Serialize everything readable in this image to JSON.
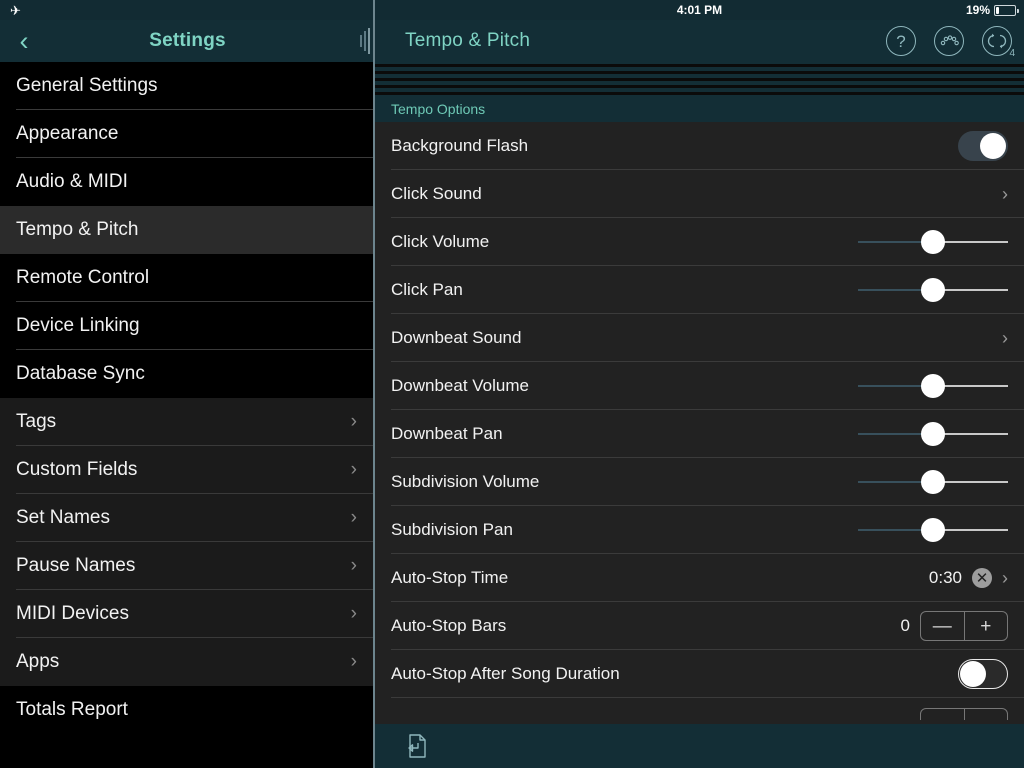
{
  "status_bar": {
    "airplane_icon": "airplane-mode-icon",
    "time": "4:01 PM",
    "battery_percent": "19%",
    "battery_level": 19
  },
  "sidebar": {
    "title": "Settings",
    "back_icon": "back-chevron-icon",
    "items": [
      {
        "label": "General Settings",
        "chevron": false,
        "group": false,
        "selected": false
      },
      {
        "label": "Appearance",
        "chevron": false,
        "group": false,
        "selected": false
      },
      {
        "label": "Audio & MIDI",
        "chevron": false,
        "group": false,
        "selected": false
      },
      {
        "label": "Tempo & Pitch",
        "chevron": false,
        "group": false,
        "selected": true
      },
      {
        "label": "Remote Control",
        "chevron": false,
        "group": false,
        "selected": false
      },
      {
        "label": "Device Linking",
        "chevron": false,
        "group": false,
        "selected": false
      },
      {
        "label": "Database Sync",
        "chevron": false,
        "group": false,
        "selected": false
      },
      {
        "label": "Tags",
        "chevron": true,
        "group": true,
        "selected": false
      },
      {
        "label": "Custom Fields",
        "chevron": true,
        "group": true,
        "selected": false
      },
      {
        "label": "Set Names",
        "chevron": true,
        "group": true,
        "selected": false
      },
      {
        "label": "Pause Names",
        "chevron": true,
        "group": true,
        "selected": false
      },
      {
        "label": "MIDI Devices",
        "chevron": true,
        "group": true,
        "selected": false
      },
      {
        "label": "Apps",
        "chevron": true,
        "group": true,
        "selected": false
      },
      {
        "label": "Totals Report",
        "chevron": false,
        "group": false,
        "selected": false
      }
    ]
  },
  "detail": {
    "title": "Tempo & Pitch",
    "actions": [
      {
        "name": "help-button",
        "icon": "question-mark-icon",
        "glyph": "?",
        "badge": ""
      },
      {
        "name": "metronome-button",
        "icon": "metronome-icon",
        "glyph": "",
        "badge": ""
      },
      {
        "name": "loop-button",
        "icon": "loop-icon",
        "glyph": "",
        "badge": "4"
      }
    ],
    "section_header": "Tempo Options",
    "rows": [
      {
        "label": "Background Flash",
        "control": "toggle",
        "value": "on"
      },
      {
        "label": "Click Sound",
        "control": "chevron",
        "value": ""
      },
      {
        "label": "Click Volume",
        "control": "slider",
        "value": 50
      },
      {
        "label": "Click Pan",
        "control": "slider",
        "value": 50
      },
      {
        "label": "Downbeat Sound",
        "control": "chevron",
        "value": ""
      },
      {
        "label": "Downbeat Volume",
        "control": "slider",
        "value": 50
      },
      {
        "label": "Downbeat Pan",
        "control": "slider",
        "value": 50
      },
      {
        "label": "Subdivision Volume",
        "control": "slider",
        "value": 50
      },
      {
        "label": "Subdivision Pan",
        "control": "slider",
        "value": 50
      },
      {
        "label": "Auto-Stop Time",
        "control": "value-clear-chevron",
        "value": "0:30"
      },
      {
        "label": "Auto-Stop Bars",
        "control": "stepper",
        "value": "0"
      },
      {
        "label": "Auto-Stop After Song Duration",
        "control": "toggle",
        "value": "off"
      }
    ],
    "stepper": {
      "minus_label": "—",
      "plus_label": "+"
    },
    "clear_label": "✕",
    "chevron_label": "›"
  },
  "toolbar": {
    "document_back_icon": "document-back-icon"
  },
  "colors": {
    "nav_bg": "#132e36",
    "accent_teal": "#7fd4c4",
    "section_label": "#6ec9b6",
    "panel_bg": "#222222",
    "sidebar_bg": "#000000",
    "sidebar_group_bg": "#1b1b1b",
    "sidebar_selected_bg": "#2b2b2b",
    "toggle_on_track": "#38434c",
    "slider_left_track": "#38505c",
    "slider_right_track": "#c8c8c8"
  }
}
